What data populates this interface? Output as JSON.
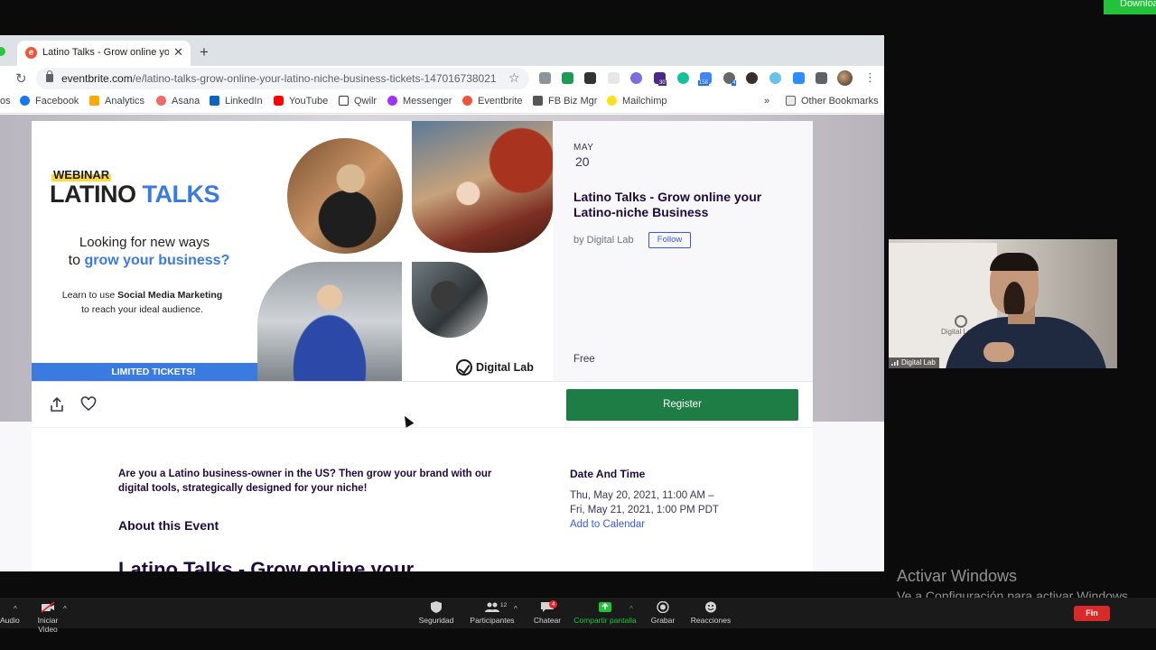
{
  "download_label": "Download",
  "browser": {
    "tab_title": "Latino Talks - Grow online your Latino-niche Business Tickets",
    "url_domain": "eventbrite.com",
    "url_path": "/e/latino-talks-grow-online-your-latino-niche-business-tickets-147016738021",
    "bookmarks": [
      "Facebook",
      "Analytics",
      "Asana",
      "LinkedIn",
      "YouTube",
      "Qwilr",
      "Messenger",
      "Eventbrite",
      "FB Biz Mgr",
      "Mailchimp"
    ],
    "bookmarks_leading_fragment": "os",
    "bookmarks_overflow": "»",
    "other_bookmarks": "Other Bookmarks",
    "extension_badges": [
      "30",
      "158",
      "4"
    ]
  },
  "banner": {
    "tag": "WEBINAR",
    "brand_a": "LATINO ",
    "brand_b": "TALKS",
    "line1": "Looking for new ways",
    "line2_a": "to ",
    "line2_b": "grow your business?",
    "learn_a": "Learn to use ",
    "learn_b": "Social Media Marketing",
    "learn_c": "to reach your ideal audience.",
    "limited": "LIMITED TICKETS!",
    "logo_text": "Digital Lab"
  },
  "event": {
    "month": "MAY",
    "day": "20",
    "title": "Latino Talks - Grow online your Latino-niche Business",
    "organizer": "by Digital Lab",
    "follow_label": "Follow",
    "price": "Free",
    "register_label": "Register",
    "lede": "Are you a Latino business-owner in the US? Then grow your brand with our digital tools, strategically designed for your niche!",
    "about_heading": "About this Event",
    "big_title": "Latino Talks - Grow online your",
    "date_heading": "Date And Time",
    "date_line1": "Thu, May 20, 2021, 11:00 AM –",
    "date_line2": "Fri, May 21, 2021, 1:00 PM PDT",
    "add_calendar": "Add to Calendar"
  },
  "webcam": {
    "name": "Digital Lab",
    "wall_logo": "Digital Lab"
  },
  "watermark": {
    "line1": "Activar Windows",
    "line2": "Ve a Configuración para activar Windows."
  },
  "zoom": {
    "audio": "Audio",
    "video": "Iniciar Video",
    "security": "Seguridad",
    "participants": "Participantes",
    "participants_count": "12",
    "chat": "Chatear",
    "chat_badge": "4",
    "share": "Compartir pantalla",
    "record": "Grabar",
    "reactions": "Reacciones",
    "end": "Fin"
  },
  "colors": {
    "eventbrite_orange": "#f05537",
    "register_green": "#1d7d45",
    "banner_blue": "#3b7be0",
    "zoom_green": "#20c33a",
    "zoom_end_red": "#d92a2a"
  }
}
